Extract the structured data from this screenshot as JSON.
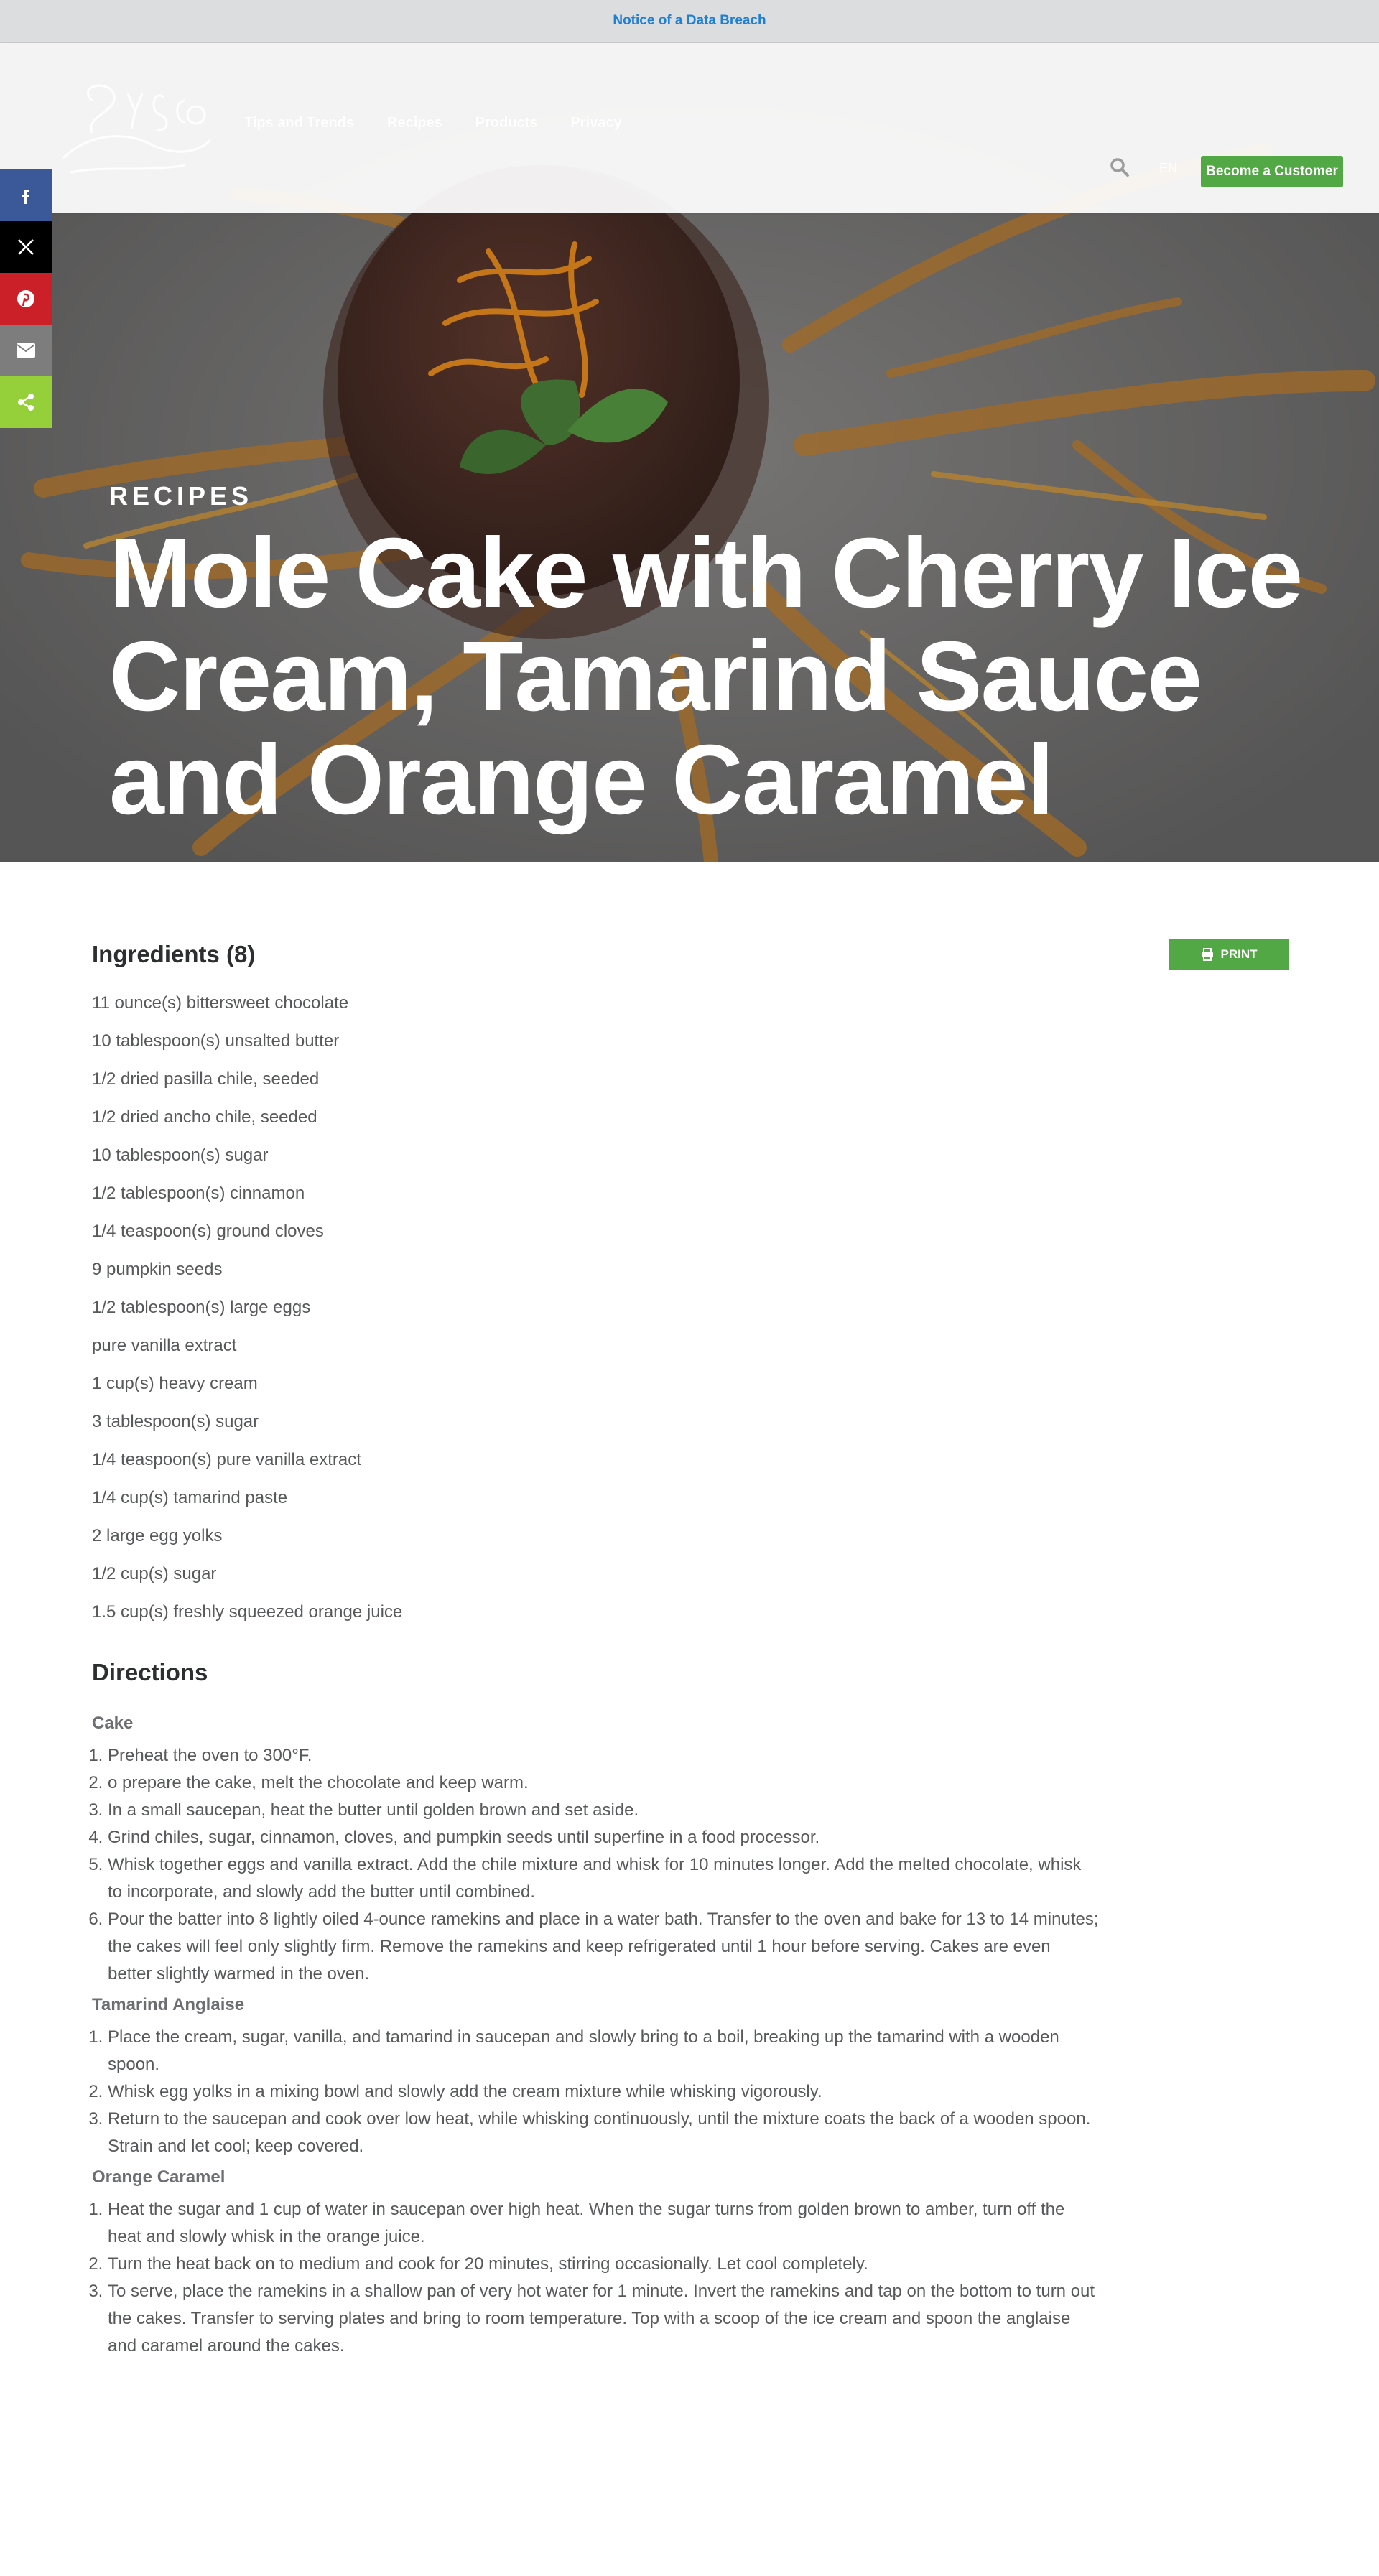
{
  "notice": {
    "text": "Notice of a Data Breach"
  },
  "header": {
    "logo_alt": "Sysco",
    "nav": [
      "Tips and Trends",
      "Recipes",
      "Products",
      "Privacy"
    ],
    "lang": "EN",
    "cta_label": "Become a Customer"
  },
  "social": [
    {
      "name": "facebook",
      "color": "#3b5998"
    },
    {
      "name": "x",
      "color": "#000000"
    },
    {
      "name": "pinterest",
      "color": "#cb2027"
    },
    {
      "name": "email",
      "color": "#7d7d7d"
    },
    {
      "name": "share",
      "color": "#95d03a"
    }
  ],
  "hero": {
    "eyebrow": "RECIPES",
    "title": "Mole Cake with Cherry Ice Cream, Tamarind Sauce and Orange Caramel"
  },
  "ingredients": {
    "heading": "Ingredients (8)",
    "print_label": "PRINT",
    "items": [
      "11 ounce(s) bittersweet chocolate",
      "10 tablespoon(s) unsalted butter",
      "1/2 dried pasilla chile, seeded",
      "1/2 dried ancho chile, seeded",
      "10 tablespoon(s) sugar",
      "1/2 tablespoon(s) cinnamon",
      "1/4 teaspoon(s) ground cloves",
      "9 pumpkin seeds",
      "1/2 tablespoon(s) large eggs",
      "pure vanilla extract",
      "1 cup(s) heavy cream",
      "3 tablespoon(s) sugar",
      "1/4 teaspoon(s) pure vanilla extract",
      "1/4 cup(s) tamarind paste",
      "2 large egg yolks",
      "1/2 cup(s) sugar",
      "1.5 cup(s) freshly squeezed orange juice"
    ]
  },
  "directions": {
    "heading": "Directions",
    "sections": [
      {
        "title": "Cake",
        "steps": [
          "Preheat the oven to 300°F.",
          "o prepare the cake, melt the chocolate and keep warm.",
          "In a small saucepan, heat the butter until golden brown and set aside.",
          "Grind chiles, sugar, cinnamon, cloves, and pumpkin seeds until superfine in a food processor.",
          "Whisk together eggs and vanilla extract. Add the chile mixture and whisk for 10 minutes longer. Add the melted chocolate, whisk to incorporate, and slowly add the butter until combined.",
          "Pour the batter into 8 lightly oiled 4-ounce ramekins and place in a water bath. Transfer to the oven and bake for 13 to 14 minutes; the cakes will feel only slightly firm. Remove the ramekins and keep refrigerated until 1 hour before serving. Cakes are even better slightly warmed in the oven."
        ]
      },
      {
        "title": "Tamarind Anglaise",
        "steps": [
          "Place the cream, sugar, vanilla, and tamarind in saucepan and slowly bring to a boil, breaking up the tamarind with a wooden spoon.",
          "Whisk egg yolks in a mixing bowl and slowly add the cream mixture while whisking vigorously.",
          "Return to the saucepan and cook over low heat, while whisking continuously, until the mixture coats the back of a wooden spoon. Strain and let cool; keep covered."
        ]
      },
      {
        "title": "Orange Caramel",
        "steps": [
          "Heat the sugar and 1 cup of water in saucepan over high heat. When the sugar turns from golden brown to amber, turn off the heat and slowly whisk in the orange juice.",
          "Turn the heat back on to medium and cook for 20 minutes, stirring occasionally. Let cool completely.",
          "To serve, place the ramekins in a shallow pan of very hot water for 1 minute. Invert the ramekins and tap on the bottom to turn out the cakes. Transfer to serving plates and bring to room temperature. Top with a scoop of the ice cream and spoon the anglaise and caramel around the cakes."
        ]
      }
    ]
  }
}
